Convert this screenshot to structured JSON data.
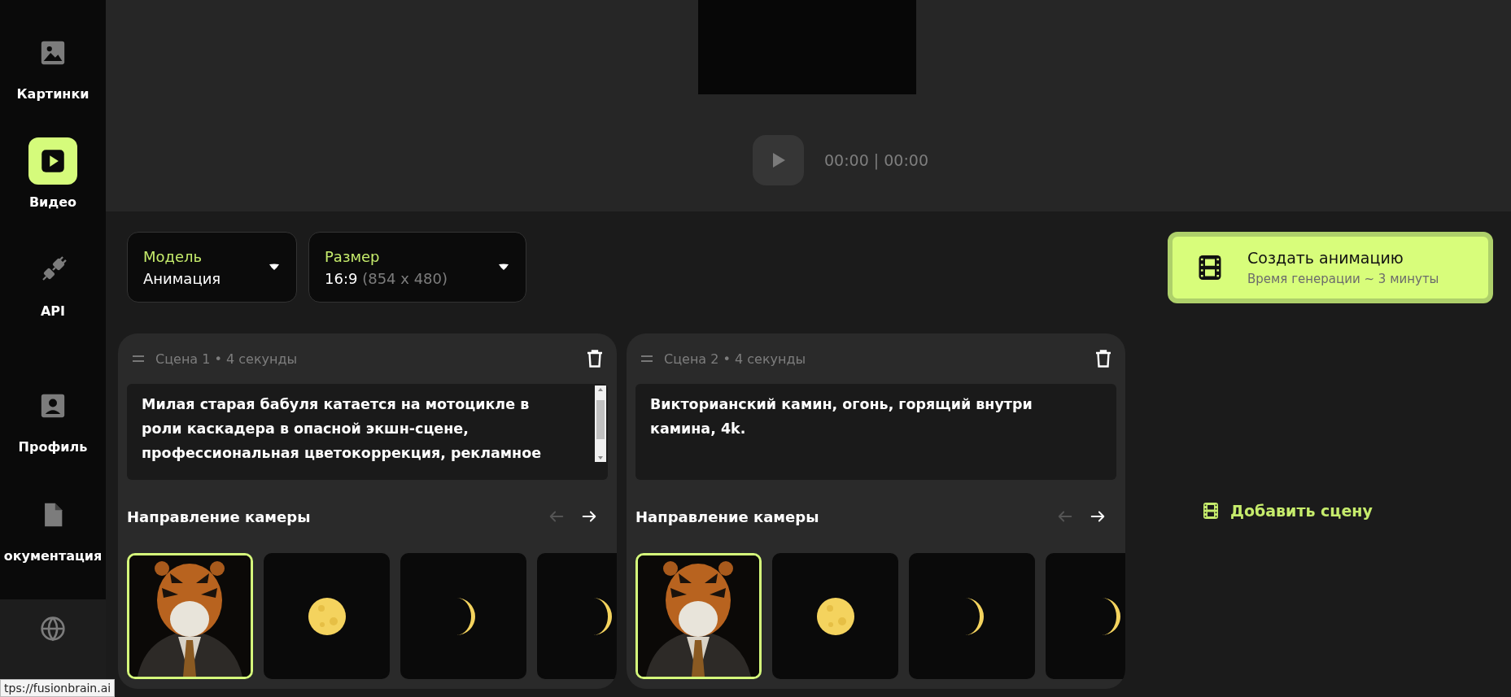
{
  "sidebar": {
    "items": [
      {
        "kind": "images",
        "label": "Картинки",
        "selected": false
      },
      {
        "kind": "video",
        "label": "Видео",
        "selected": true
      },
      {
        "kind": "api",
        "label": "API",
        "selected": false
      },
      {
        "kind": "profile",
        "label": "Профиль",
        "selected": false
      },
      {
        "kind": "docs",
        "label": "окументация",
        "selected": false
      }
    ]
  },
  "status_url": "tps://fusionbrain.ai",
  "player": {
    "time": "00:00 | 00:00"
  },
  "dropdowns": [
    {
      "label": "Модель",
      "value": "Анимация"
    },
    {
      "label": "Размер",
      "value": "16:9",
      "detail": "(854 x 480)"
    }
  ],
  "create_button": {
    "title": "Создать анимацию",
    "subtitle": "Время генерации ~ 3 минуты"
  },
  "add_scene": "Добавить сцену",
  "scenes": [
    {
      "title": "Сцена 1 • 4 секунды",
      "prompt": "Милая старая бабуля катается на мотоцикле в роли каскадера в опасной экшн-сцене, профессиональная цветокоррекция, рекламное",
      "scrollbar": true,
      "camera_label": "Направление камеры",
      "prev_enabled": false,
      "next_enabled": true,
      "thumbnails": [
        {
          "kind": "picture",
          "selected": true
        },
        {
          "kind": "full_moon",
          "selected": false
        },
        {
          "kind": "crescent",
          "selected": false
        },
        {
          "kind": "crescent",
          "selected": false
        }
      ]
    },
    {
      "title": "Сцена 2 • 4 секунды",
      "prompt": "Викторианский камин, огонь, горящий внутри камина, 4k.",
      "scrollbar": false,
      "camera_label": "Направление камеры",
      "prev_enabled": false,
      "next_enabled": true,
      "thumbnails": [
        {
          "kind": "picture",
          "selected": true
        },
        {
          "kind": "full_moon",
          "selected": false
        },
        {
          "kind": "crescent",
          "selected": false
        },
        {
          "kind": "crescent",
          "selected": false
        }
      ]
    }
  ]
}
